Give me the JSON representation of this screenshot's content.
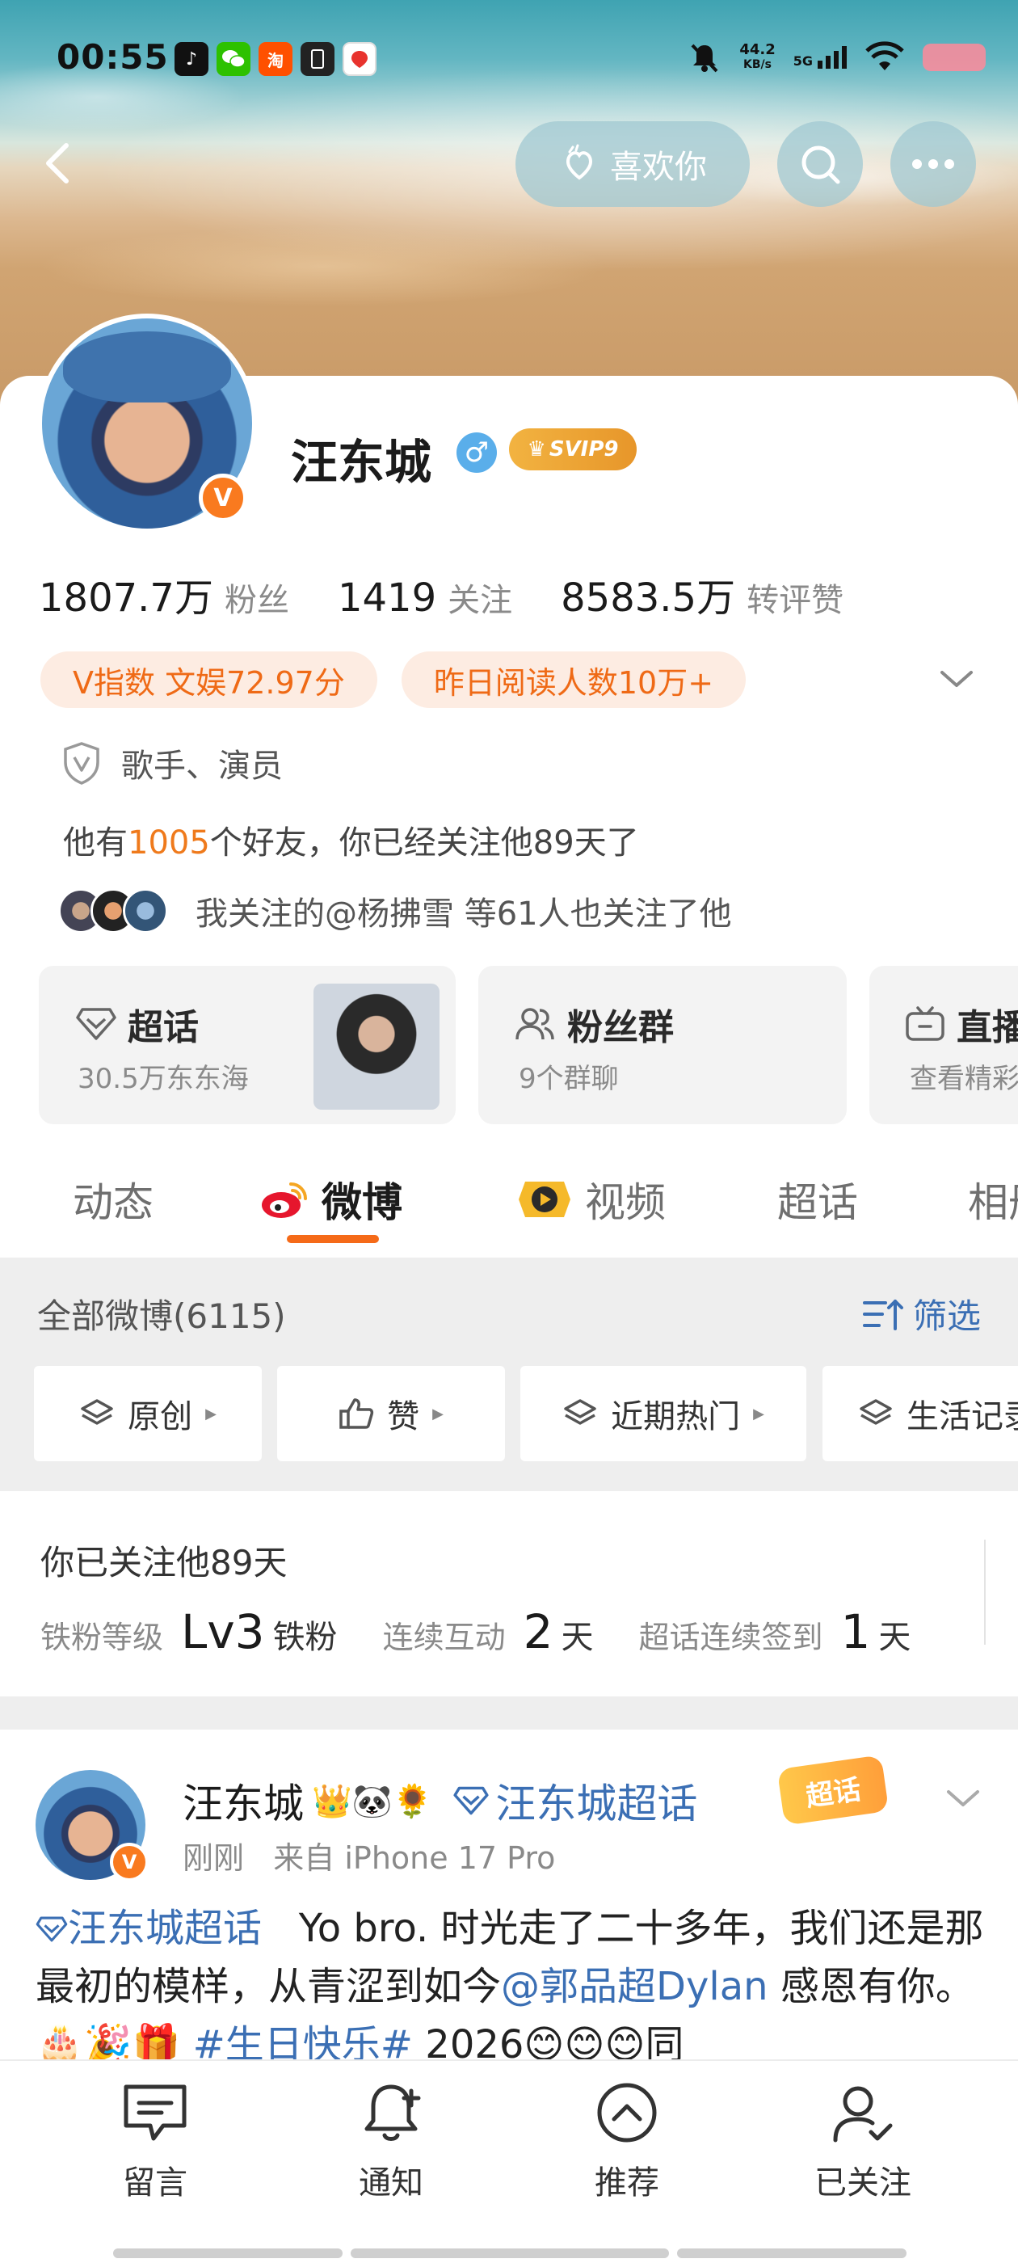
{
  "status_bar": {
    "time": "00:55",
    "net_speed_value": "44.2",
    "net_speed_unit": "KB/s",
    "signal_label": "5G",
    "apps": [
      "tiktok-icon",
      "wechat-icon",
      "taobao-icon",
      "app-icon",
      "app-icon"
    ]
  },
  "header": {
    "like_button": "喜欢你"
  },
  "profile": {
    "name": "汪东城",
    "gender_symbol": "♂",
    "vip_badge": "SVIP9",
    "verified_badge": "V",
    "stats": [
      {
        "value": "1807.7万",
        "label": "粉丝"
      },
      {
        "value": "1419",
        "label": "关注"
      },
      {
        "value": "8583.5万",
        "label": "转评赞"
      }
    ],
    "tags": [
      "V指数 文娱72.97分",
      "昨日阅读人数10万+"
    ],
    "role": "歌手、演员",
    "friends_prefix": "他有",
    "friends_count": "1005",
    "friends_suffix": "个好友，你已经关注他89天了",
    "followed_by": "我关注的@杨拂雪 等61人也关注了他"
  },
  "features": [
    {
      "title": "超话",
      "subtitle": "30.5万东东海",
      "icon": "diamond-icon"
    },
    {
      "title": "粉丝群",
      "subtitle": "9个群聊",
      "icon": "group-icon"
    },
    {
      "title": "直播",
      "subtitle": "查看精彩",
      "icon": "tv-icon"
    }
  ],
  "tabs": [
    {
      "label": "动态",
      "active": false
    },
    {
      "label": "微博",
      "active": true
    },
    {
      "label": "视频",
      "active": false
    },
    {
      "label": "超话",
      "active": false
    },
    {
      "label": "相册",
      "active": false
    }
  ],
  "feed": {
    "all_posts_label": "全部微博(6115)",
    "filter_label": "筛选",
    "chips": [
      "原创",
      "赞",
      "近期热门",
      "生活记录"
    ]
  },
  "fan_card": {
    "title": "你已关注他89天",
    "level_label": "铁粉等级",
    "level_value": "Lv3",
    "level_unit": "铁粉",
    "interact_label": "连续互动",
    "interact_value": "2",
    "interact_unit": "天",
    "checkin_label": "超话连续签到",
    "checkin_value": "1",
    "checkin_unit": "天"
  },
  "post": {
    "author": "汪东城",
    "author_emojis": "👑🐼🌻",
    "supertopic": "汪东城超话",
    "badge": "超话",
    "time": "刚刚",
    "source": "来自 iPhone 17 Pro",
    "body_tag": "汪东城超话",
    "body_text_1": "Yo bro. 时光走了二十多年，我们还是那最初的模样，从青涩到如今",
    "body_mention": "@郭品超Dylan",
    "body_text_2": "感恩有你。🎂🎉🎁",
    "body_hashtag": "#生日快乐#",
    "body_text_3": " 2026😊😊😊同"
  },
  "bottom_bar": [
    {
      "label": "留言",
      "icon": "comment-icon"
    },
    {
      "label": "通知",
      "icon": "bell-icon"
    },
    {
      "label": "推荐",
      "icon": "recommend-icon"
    },
    {
      "label": "已关注",
      "icon": "followed-icon"
    }
  ],
  "colors": {
    "accent_orange": "#f56a18",
    "link_blue": "#3b6fb4",
    "tag_bg": "#fdece2"
  }
}
